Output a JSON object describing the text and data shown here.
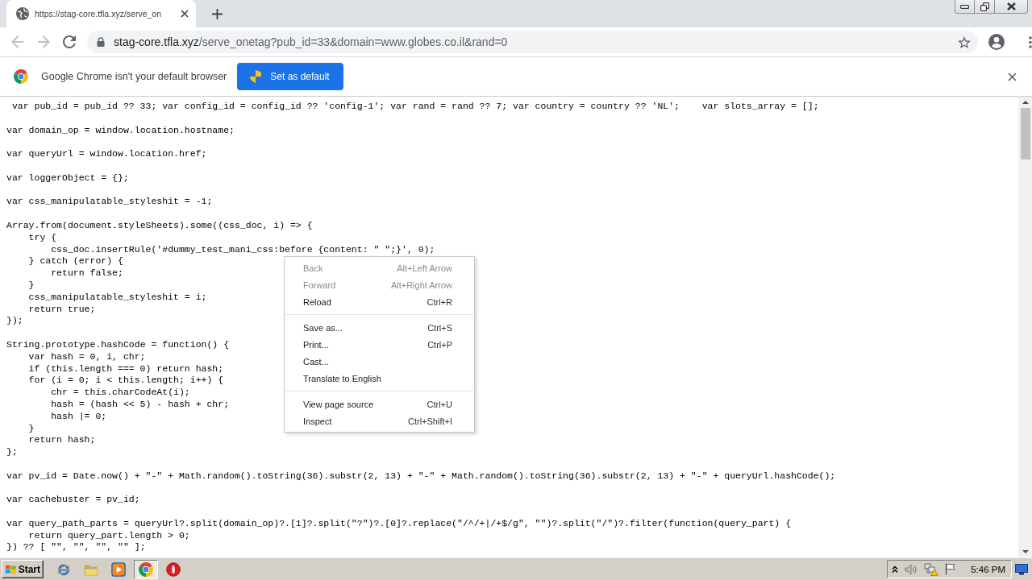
{
  "tabs": [
    {
      "title": "https://stag-core.tfla.xyz/serve_on",
      "selected": true
    }
  ],
  "nav_buttons": [
    {
      "kind": "back",
      "disabled": true
    },
    {
      "kind": "forward",
      "disabled": true
    },
    {
      "kind": "reload",
      "disabled": false
    }
  ],
  "address_bar": {
    "host": "stag-core.tfla.xyz",
    "path": "/serve_onetag?pub_id=33&domain=www.globes.co.il&rand=0"
  },
  "infobar": {
    "message": "Google Chrome isn't your default browser",
    "button": "Set as default"
  },
  "code_blocks": [
    [
      " var pub_id = pub_id ?? 33; var config_id = config_id ?? 'config-1'; var rand = rand ?? 7; var country = country ?? 'NL';    var slots_array = [];"
    ],
    [
      "var domain_op = window.location.hostname;"
    ],
    [
      "var queryUrl = window.location.href;"
    ],
    [
      "var loggerObject = {};"
    ],
    [
      "var css_manipulatable_styleshit = -1;"
    ],
    [
      "Array.from(document.styleSheets).some((css_doc, i) => {",
      "    try {",
      "        css_doc.insertRule('#dummy_test_mani_css:before {content: \" \";}', 0);",
      "    } catch (error) {",
      "        return false;",
      "    }",
      "    css_manipulatable_styleshit = i;",
      "    return true;",
      "});"
    ],
    [
      "String.prototype.hashCode = function() {",
      "    var hash = 0, i, chr;",
      "    if (this.length === 0) return hash;",
      "    for (i = 0; i < this.length; i++) {",
      "        chr = this.charCodeAt(i);",
      "        hash = (hash << 5) - hash + chr;",
      "        hash |= 0;",
      "    }",
      "    return hash;",
      "};"
    ],
    [
      "var pv_id = Date.now() + \"-\" + Math.random().toString(36).substr(2, 13) + \"-\" + Math.random().toString(36).substr(2, 13) + \"-\" + queryUrl.hashCode();"
    ],
    [
      "var cachebuster = pv_id;"
    ],
    [
      "var query_path_parts = queryUrl?.split(domain_op)?.[1]?.split(\"?\")?.[0]?.replace(\"/^/+|/+$/g\", \"\")?.split(\"/\")?.filter(function(query_part) {",
      "    return query_part.length > 0;",
      "}) ?? [ \"\", \"\", \"\", \"\" ];"
    ]
  ],
  "context_menu": {
    "groups": [
      [
        {
          "label": "Back",
          "shortcut": "Alt+Left Arrow",
          "disabled": true
        },
        {
          "label": "Forward",
          "shortcut": "Alt+Right Arrow",
          "disabled": true
        },
        {
          "label": "Reload",
          "shortcut": "Ctrl+R",
          "disabled": false
        }
      ],
      [
        {
          "label": "Save as...",
          "shortcut": "Ctrl+S",
          "disabled": false
        },
        {
          "label": "Print...",
          "shortcut": "Ctrl+P",
          "disabled": false
        },
        {
          "label": "Cast...",
          "disabled": false
        },
        {
          "label": "Translate to English",
          "disabled": false
        }
      ],
      [
        {
          "label": "View page source",
          "shortcut": "Ctrl+U",
          "disabled": false
        },
        {
          "label": "Inspect",
          "shortcut": "Ctrl+Shift+I",
          "disabled": false
        }
      ]
    ]
  },
  "taskbar": {
    "start_button": "Start",
    "apps": [
      {
        "kind": "ie",
        "selected": false
      },
      {
        "kind": "explorer",
        "selected": false
      },
      {
        "kind": "mediaplayer",
        "selected": false
      },
      {
        "kind": "chrome",
        "selected": true
      },
      {
        "kind": "stop",
        "selected": false
      }
    ],
    "clock": "5:46 PM"
  }
}
